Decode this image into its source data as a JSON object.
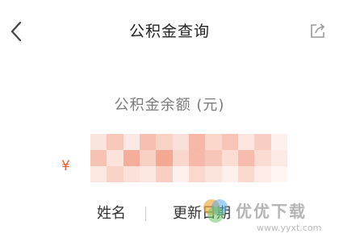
{
  "header": {
    "title": "公积金查询",
    "back_icon": "back-chevron-icon",
    "share_icon": "share-icon"
  },
  "balance": {
    "label": "公积金余额 (元)",
    "currency_symbol": "¥",
    "value_masked": true
  },
  "info_row": {
    "name_label": "姓名",
    "date_label": "更新日期"
  },
  "watermark": {
    "text": "优优下载",
    "url": "www.yyxt.com"
  },
  "colors": {
    "accent": "#ef5a2a",
    "label_gray": "#7a7a7a"
  }
}
